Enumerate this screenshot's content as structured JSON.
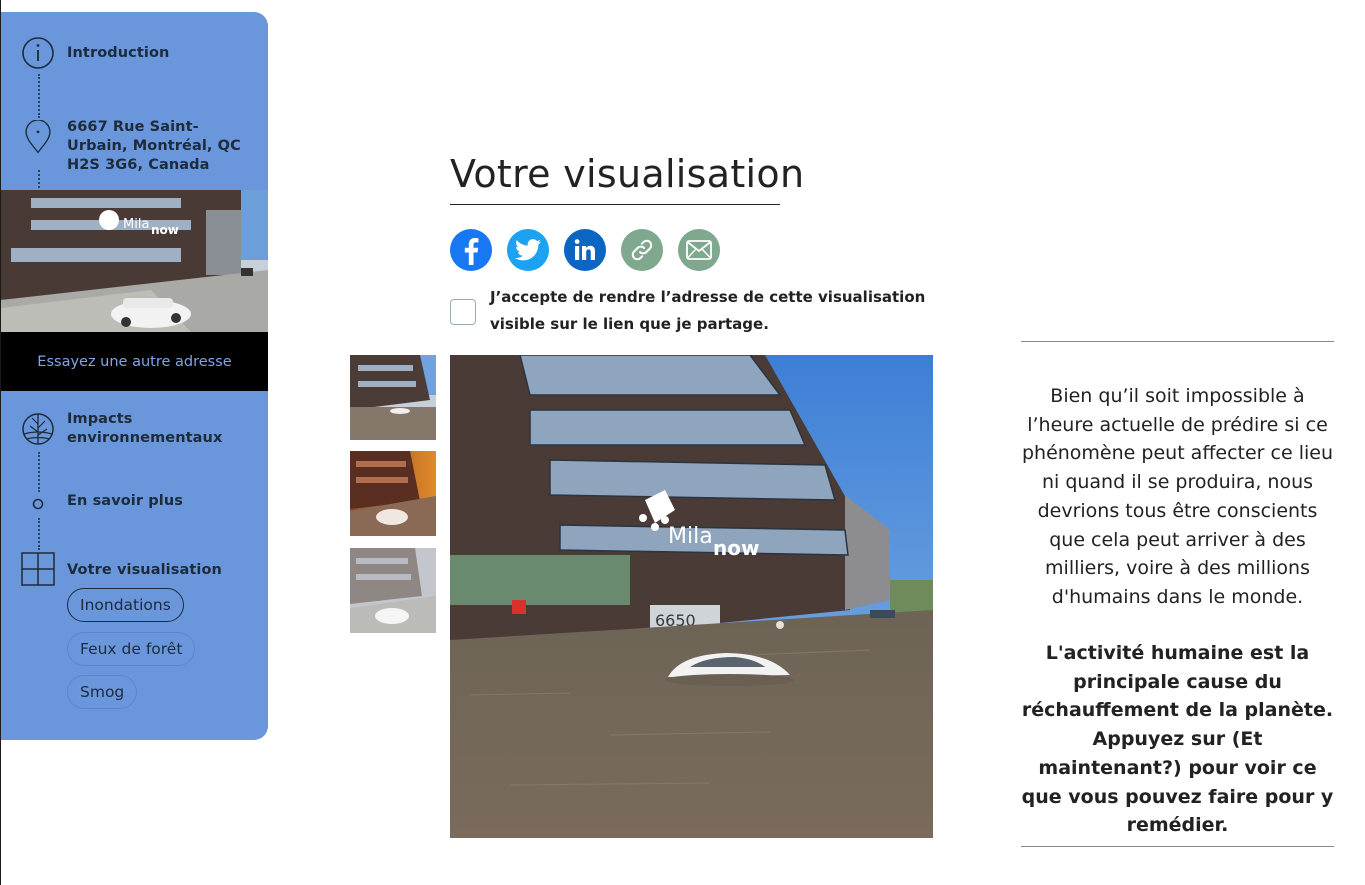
{
  "sidebar": {
    "steps": {
      "intro": "Introduction",
      "address": "6667 Rue Saint-Urbain, Montréal, QC H2S 3G6, Canada",
      "impacts": "Impacts environnementaux",
      "more": "En savoir plus",
      "viz": "Votre visualisation"
    },
    "try_other": "Essayez une autre adresse",
    "options": {
      "floods": "Inondations",
      "fires": "Feux de forêt",
      "smog": "Smog"
    }
  },
  "main": {
    "title": "Votre visualisation",
    "share": {
      "facebook": "facebook-icon",
      "twitter": "twitter-icon",
      "linkedin": "linkedin-icon",
      "link": "link-icon",
      "email": "email-icon"
    },
    "consent": "J’accepte de rendre l’adresse de cette visualisation visible sur le lien que je partage.",
    "sign_text": {
      "brand": "Mila",
      "tag": "now",
      "number": "6650"
    }
  },
  "info": {
    "paragraph": "Bien qu’il soit impossible à l’heure actuelle de prédire si ce phénomène peut affecter ce lieu ni quand il se produira, nous devrions tous être conscients que cela peut arriver à des milliers, voire à des millions d'humains dans le monde.",
    "bold": "L'activité humaine est la principale cause du réchauffement de la planète. Appuyez sur (Et maintenant?) pour voir ce que vous pouvez faire pour y remédier."
  },
  "colors": {
    "sidebar": "#6a97dc",
    "facebook": "#1877f2",
    "twitter": "#1da1f2",
    "linkedin": "#0a66c2",
    "link": "#7fa88f",
    "email": "#7fa88f"
  }
}
